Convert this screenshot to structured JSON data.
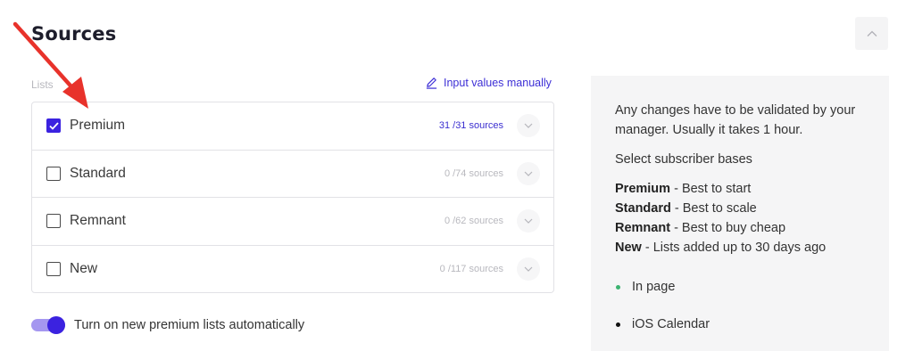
{
  "section": {
    "title": "Sources"
  },
  "lists": {
    "label": "Lists",
    "manual_link": "Input values manually",
    "items": [
      {
        "label": "Premium",
        "count": "31 /31  sources",
        "checked": true
      },
      {
        "label": "Standard",
        "count": "0 /74 sources",
        "checked": false
      },
      {
        "label": "Remnant",
        "count": "0 /62 sources",
        "checked": false
      },
      {
        "label": "New",
        "count": "0 /117 sources",
        "checked": false
      }
    ]
  },
  "toggle": {
    "label": "Turn on new premium lists automatically",
    "on": true
  },
  "info": {
    "notice_line1": "Any changes have to be validated by your",
    "notice_line2": "manager. Usually it takes 1 hour.",
    "select_text": "Select subscriber bases",
    "bases": [
      {
        "name": "Premium",
        "desc": " - Best to start"
      },
      {
        "name": "Standard",
        "desc": " - Best to scale"
      },
      {
        "name": "Remnant",
        "desc": " - Best to buy cheap"
      },
      {
        "name": "New",
        "desc": " - Lists added up to 30 days ago"
      }
    ],
    "legend": [
      {
        "label": "In page",
        "color": "#3cb371"
      },
      {
        "label": "iOS Calendar",
        "color": "#111111"
      }
    ]
  },
  "colors": {
    "accent": "#3b22e0",
    "annotation_arrow": "#e8322b"
  }
}
